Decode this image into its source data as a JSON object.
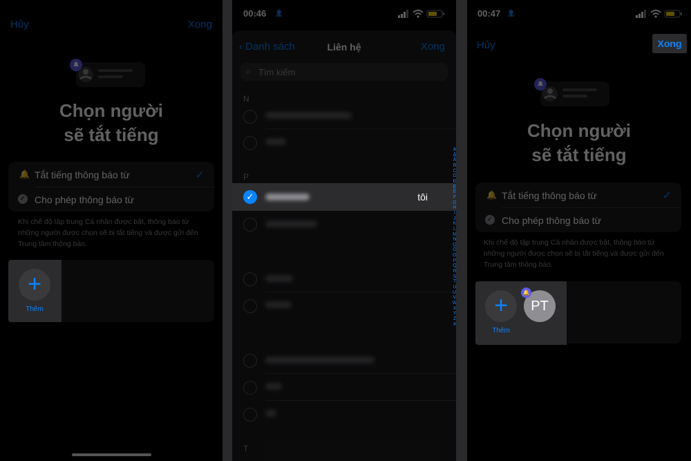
{
  "panel1": {
    "nav": {
      "cancel": "Hủy",
      "done": "Xong"
    },
    "title_line1": "Chọn người",
    "title_line2": "sẽ tắt tiếng",
    "options": [
      {
        "label": "Tắt tiếng thông báo từ",
        "selected": true
      },
      {
        "label": "Cho phép thông báo từ",
        "selected": false
      }
    ],
    "footnote": [
      "Khi chế độ tập trung Cá nhân được bật, thông báo từ",
      "những người được chọn sẽ bị tắt tiếng và được gửi đến",
      "Trung tâm thông báo."
    ],
    "add_label": "Thêm"
  },
  "panel2": {
    "status_time": "00:46",
    "nav": {
      "back": "Danh sách",
      "title": "Liên hệ",
      "done": "Xong"
    },
    "search_placeholder": "Tìm kiếm",
    "sections": [
      "N",
      "P",
      "T"
    ],
    "selected_contact": {
      "tag": "tôi",
      "checked": true
    },
    "index_letters": [
      "A",
      "Ă",
      "Â",
      "B",
      "C",
      "D",
      "Đ",
      "E",
      "Ê",
      "F",
      "G",
      "H",
      "I",
      "J",
      "K",
      "L",
      "M",
      "N",
      "O",
      "Ô",
      "Ơ",
      "P",
      "Q",
      "R",
      "S",
      "T",
      "U",
      "Ư",
      "V",
      "W",
      "X",
      "Y",
      "Z",
      "#"
    ]
  },
  "panel3": {
    "status_time": "00:47",
    "nav": {
      "cancel": "Hủy",
      "done": "Xong"
    },
    "title_line1": "Chọn người",
    "title_line2": "sẽ tắt tiếng",
    "options": [
      {
        "label": "Tắt tiếng thông báo từ",
        "selected": true
      },
      {
        "label": "Cho phép thông báo từ",
        "selected": false
      }
    ],
    "footnote": [
      "Khi chế độ tập trung Cá nhân được bật, thông báo từ",
      "những người được chọn sẽ bị tắt tiếng và được gửi đến",
      "Trung tâm thông báo."
    ],
    "add_label": "Thêm",
    "contact_initials": "PT"
  },
  "colors": {
    "accent": "#0a84ff",
    "focus_purple": "#5e5ce6",
    "background": "#000000",
    "card": "#1c1c1e"
  }
}
